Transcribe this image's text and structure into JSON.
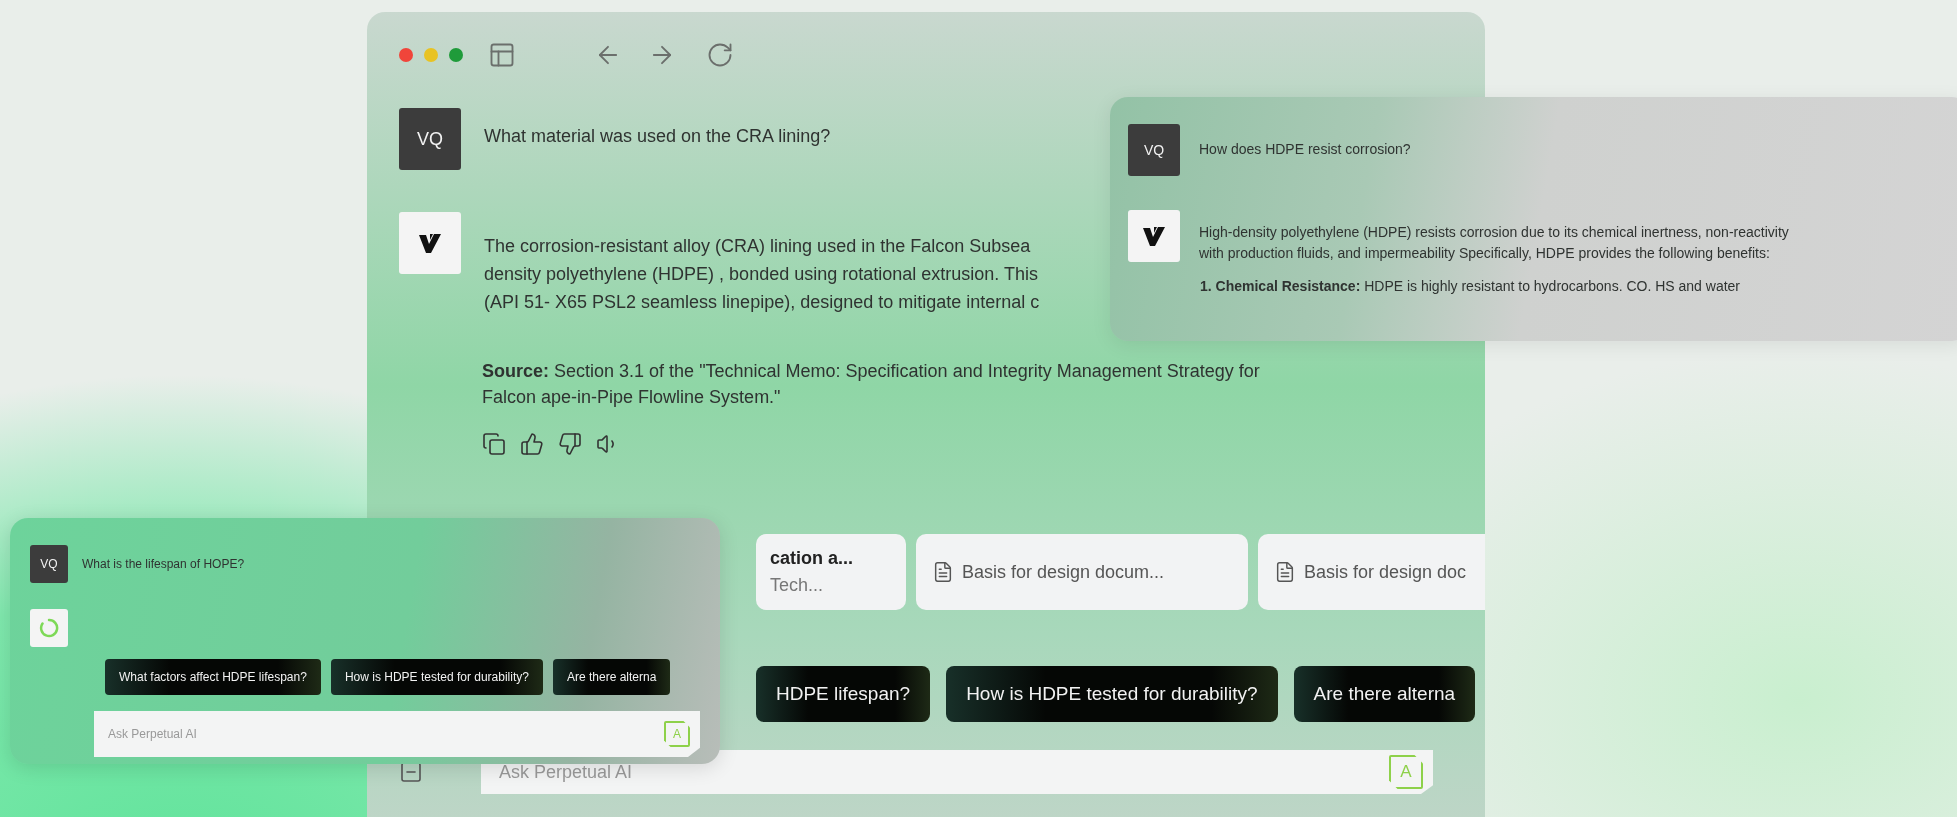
{
  "main_window": {
    "messages": [
      {
        "kind": "user",
        "avatar": "VQ",
        "text": "What material was used on the CRA lining?"
      },
      {
        "kind": "assistant",
        "lines": [
          "The corrosion-resistant alloy (CRA) lining used in the Falcon Subsea",
          "density polyethylene (HDPE) , bonded using rotational extrusion. This",
          "(API 51- X65 PSL2 seamless linepipe), designed to mitigate internal c"
        ],
        "source": "**Source:** Section 3.1 of the \"Technical Memo: Specification and Integrity Management Strategy for Falcon ape-in-Pipe Flowline System.\""
      }
    ],
    "documents": [
      {
        "title": "cation a...",
        "subtitle": "Tech..."
      },
      {
        "title": "Basis for design docum..."
      },
      {
        "title": "Basis for design doc"
      }
    ],
    "suggestions": [
      "HDPE lifespan?",
      "How is HDPE tested for durability?",
      "Are there alterna"
    ],
    "input": {
      "placeholder": "Ask Perpetual AI",
      "send_label": "A"
    }
  },
  "right_window": {
    "messages": [
      {
        "kind": "user",
        "avatar": "VQ",
        "text": "How does HDPE resist corrosion?"
      },
      {
        "kind": "assistant",
        "text": "High-density polyethylene (HDPE) resists corrosion due to its chemical inertness, non-reactivity with production fluids, and impermeability Specifically, HDPE provides the following benefits:",
        "list": [
          "**1. Chemical Resistance:** HDPE is highly resistant to hydrocarbons. CO. HS and water"
        ]
      }
    ]
  },
  "left_window": {
    "messages": [
      {
        "kind": "user",
        "avatar": "VQ",
        "text": "What is the lifespan of HOPE?"
      },
      {
        "kind": "loading"
      }
    ],
    "suggestions": [
      "What factors affect HDPE lifespan?",
      "How is HDPE tested for durability?",
      "Are there alterna"
    ],
    "input": {
      "placeholder": "Ask Perpetual AI",
      "send_label": "A"
    }
  }
}
